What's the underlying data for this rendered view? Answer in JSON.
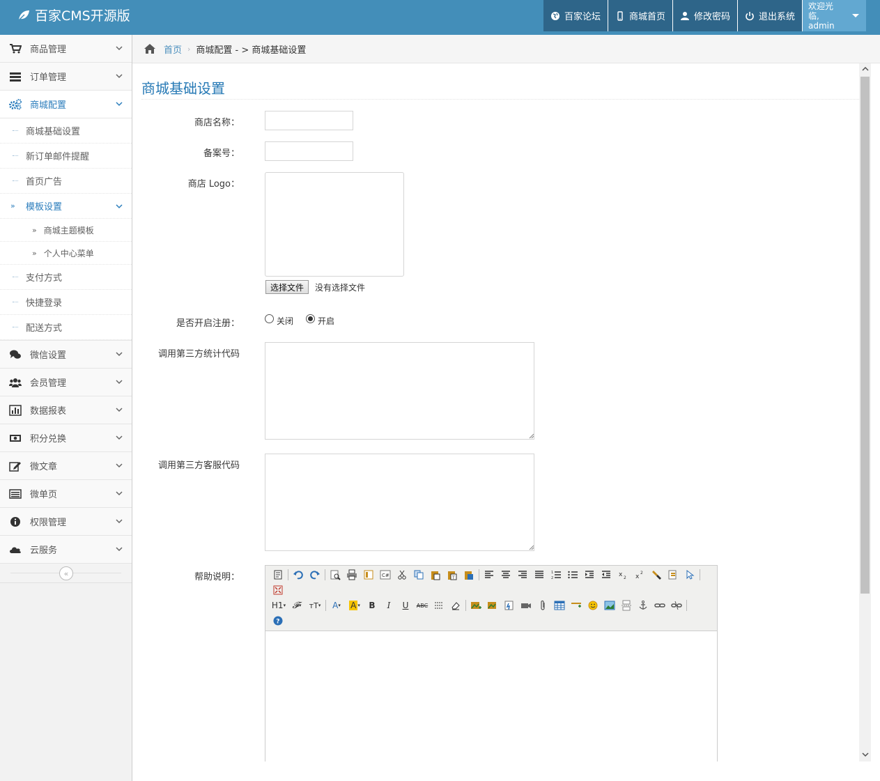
{
  "navbar": {
    "brand": "百家CMS开源版",
    "items": [
      {
        "icon": "globe-icon",
        "label": "百家论坛"
      },
      {
        "icon": "mobile-icon",
        "label": "商城首页"
      },
      {
        "icon": "user-icon",
        "label": "修改密码"
      },
      {
        "icon": "power-icon",
        "label": "退出系统"
      }
    ],
    "user": {
      "greeting": "欢迎光临,",
      "name": "admin"
    }
  },
  "sidebar": {
    "items": [
      {
        "icon": "cart-icon",
        "label": "商品管理"
      },
      {
        "icon": "list-icon",
        "label": "订单管理"
      },
      {
        "icon": "cogs-icon",
        "label": "商城配置"
      },
      {
        "icon": "comments-icon",
        "label": "微信设置"
      },
      {
        "icon": "group-icon",
        "label": "会员管理"
      },
      {
        "icon": "chart-icon",
        "label": "数据报表"
      },
      {
        "icon": "money-icon",
        "label": "积分兑换"
      },
      {
        "icon": "edit-icon",
        "label": "微文章"
      },
      {
        "icon": "page-icon",
        "label": "微单页"
      },
      {
        "icon": "info-icon",
        "label": "权限管理"
      },
      {
        "icon": "cloud-icon",
        "label": "云服务"
      }
    ],
    "config_submenu": [
      "商城基础设置",
      "新订单邮件提醒",
      "首页广告",
      "模板设置",
      "支付方式",
      "快捷登录",
      "配送方式"
    ],
    "template_submenu": [
      "商城主题模板",
      "个人中心菜单"
    ]
  },
  "breadcrumb": {
    "home": "首页",
    "current": "商城配置 - > 商城基础设置"
  },
  "page": {
    "title": "商城基础设置",
    "fields": {
      "shop_name_label": "商店名称：",
      "shop_name_value": "",
      "icp_label": "备案号：",
      "icp_value": "",
      "logo_label": "商店 Logo：",
      "file_button": "选择文件",
      "file_status": "没有选择文件",
      "register_label": "是否开启注册：",
      "register_off": "关闭",
      "register_on": "开启",
      "register_selected": "开启",
      "stats_code_label": "调用第三方统计代码",
      "stats_code_value": "",
      "service_code_label": "调用第三方客服代码",
      "service_code_value": "",
      "help_label": "帮助说明："
    }
  }
}
